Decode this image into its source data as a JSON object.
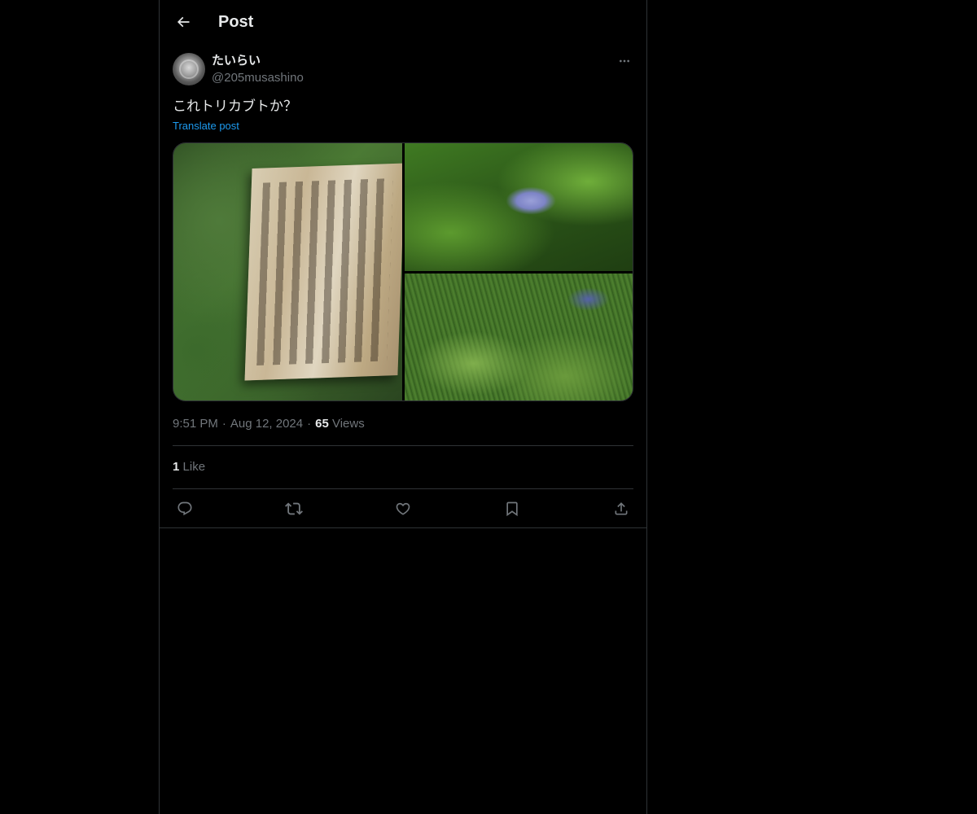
{
  "header": {
    "title": "Post",
    "back_icon": "arrow-left-icon"
  },
  "author": {
    "display_name": "たいらい",
    "handle": "@205musashino",
    "more_icon": "more-horizontal-icon"
  },
  "post": {
    "text": "これトリカブトか？",
    "translate_label": "Translate post",
    "images": [
      {
        "name": "sign-photo"
      },
      {
        "name": "flower-photo"
      },
      {
        "name": "meadow-photo"
      }
    ]
  },
  "meta": {
    "time": "9:51 PM",
    "date": "Aug 12, 2024",
    "separator": "·",
    "views_count": "65",
    "views_label": "Views"
  },
  "engagement": {
    "likes_count": "1",
    "likes_label": "Like"
  },
  "actions": {
    "reply_icon": "reply-icon",
    "repost_icon": "repost-icon",
    "like_icon": "heart-icon",
    "bookmark_icon": "bookmark-icon",
    "share_icon": "share-icon"
  },
  "colors": {
    "background": "#000000",
    "text": "#e7e9ea",
    "secondary_text": "#71767b",
    "link": "#1d9bf0",
    "border": "#2f3336"
  }
}
